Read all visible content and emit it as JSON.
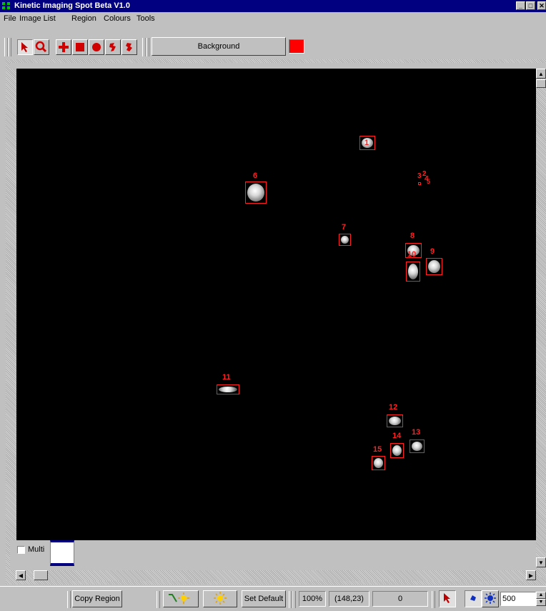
{
  "window": {
    "title": "Kinetic Imaging Spot Beta V1.0"
  },
  "menu": [
    "File",
    "Image List",
    "Region",
    "Colours",
    "Tools"
  ],
  "toolbar": {
    "background_label": "Background",
    "background_color": "#ff0000"
  },
  "spots": [
    {
      "label": "1"
    },
    {
      "label": "2"
    },
    {
      "label": "3"
    },
    {
      "label": "4"
    },
    {
      "label": "5"
    },
    {
      "label": "6"
    },
    {
      "label": "7"
    },
    {
      "label": "8"
    },
    {
      "label": "9"
    },
    {
      "label": "10"
    },
    {
      "label": "11"
    },
    {
      "label": "12"
    },
    {
      "label": "13"
    },
    {
      "label": "14"
    },
    {
      "label": "15"
    }
  ],
  "multi": {
    "label": "Multi",
    "checked": false
  },
  "statusbar": {
    "copy_region": "Copy Region",
    "set_default": "Set Default",
    "zoom": "100%",
    "coords": "(148,23)",
    "value": "0",
    "spin_value": "500"
  }
}
